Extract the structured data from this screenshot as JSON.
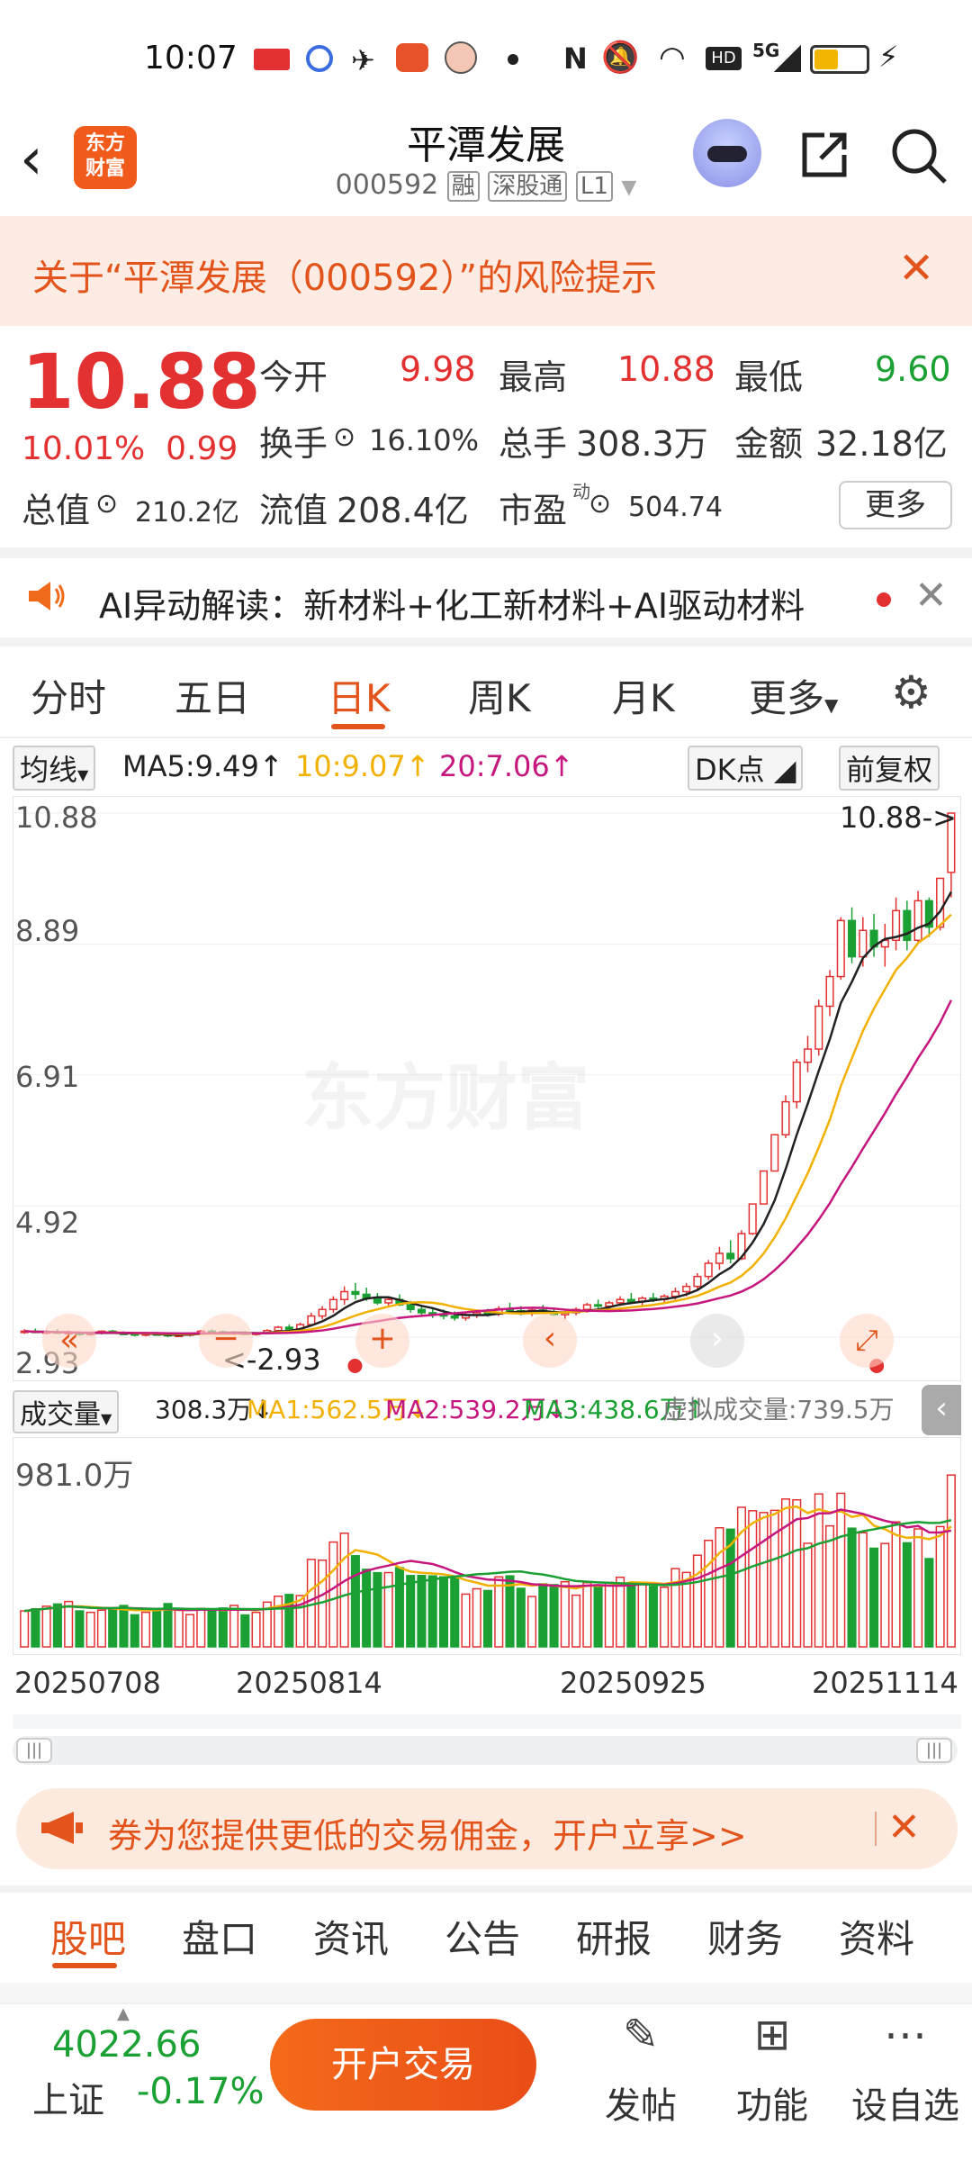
{
  "status_bar": {
    "time": "10:07",
    "network": "5G",
    "hd": "HD",
    "icons": [
      "toutiao-icon",
      "baidu-icon",
      "feather-icon",
      "gift-icon",
      "avatar-icon",
      "dot-icon",
      "nfc-icon",
      "mute-icon",
      "wifi-icon",
      "hd-icon",
      "signal-icon",
      "battery-icon",
      "charging-icon"
    ]
  },
  "header": {
    "app_logo": "东方\n财富",
    "stock_name": "平潭发展",
    "stock_code": "000592",
    "tags": [
      "融",
      "深股通",
      "L1"
    ]
  },
  "risk_banner": {
    "text": "关于“平潭发展（000592）”的风险提示"
  },
  "quote": {
    "price": "10.88",
    "change_pct": "10.01%",
    "change_amt": "0.99",
    "open_label": "今开",
    "open": "9.98",
    "high_label": "最高",
    "high": "10.88",
    "low_label": "最低",
    "low": "9.60",
    "turnover_label": "换手",
    "turnover": "16.10%",
    "volume_label": "总手",
    "volume": "308.3万",
    "amount_label": "金额",
    "amount": "32.18亿",
    "mktcap_label": "总值",
    "mktcap": "210.2亿",
    "float_label": "流值",
    "float": "208.4亿",
    "pe_label": "市盈",
    "pe_sup": "动",
    "pe": "504.74",
    "more_label": "更多"
  },
  "ai_bar": {
    "text": "AI异动解读：新材料+化工新材料+AI驱动材料"
  },
  "chart_tabs": [
    "分时",
    "五日",
    "日K",
    "周K",
    "月K",
    "更多"
  ],
  "active_chart_tab": "日K",
  "ma_row": {
    "selector": "均线",
    "ma5": "MA5:9.49",
    "ma10": "10:9.07",
    "ma20": "20:7.06",
    "dk_label": "DK点",
    "adjust_label": "前复权"
  },
  "colors": {
    "up": "#e33131",
    "down": "#1aa033",
    "ma5": "#222222",
    "ma10": "#f2b100",
    "ma20": "#c5177d",
    "accent": "#e2541b"
  },
  "kline": {
    "y_labels": [
      "10.88",
      "8.89",
      "6.91",
      "4.92",
      "2.93"
    ],
    "last_price_tag": "10.88->",
    "min_tag": "<-2.93",
    "watermark": "东方财富"
  },
  "volume_row": {
    "selector": "成交量",
    "vol": "308.3万",
    "ma1": "MA1:562.5万",
    "ma2": "MA2:539.2万",
    "ma3": "MA3:438.6万",
    "virtual": "虚拟成交量:739.5万",
    "y_label": "981.0万"
  },
  "dates": [
    "20250708",
    "20250814",
    "20250925",
    "20251114"
  ],
  "chart_data": {
    "type": "candlestick",
    "ylim": [
      2.93,
      10.88
    ],
    "y_ticks": [
      10.88,
      8.89,
      6.91,
      4.92,
      2.93
    ],
    "x_ticks": [
      "20250708",
      "20250814",
      "20250925",
      "20251114"
    ],
    "ohlc": [
      [
        3.0,
        3.05,
        2.98,
        3.02
      ],
      [
        3.02,
        3.06,
        2.99,
        3.0
      ],
      [
        3.0,
        3.04,
        2.97,
        3.01
      ],
      [
        3.01,
        3.05,
        2.98,
        2.99
      ],
      [
        2.99,
        3.03,
        2.96,
        3.0
      ],
      [
        3.0,
        3.02,
        2.95,
        2.97
      ],
      [
        2.97,
        3.01,
        2.95,
        2.99
      ],
      [
        2.99,
        3.03,
        2.97,
        3.02
      ],
      [
        3.02,
        3.04,
        2.98,
        2.99
      ],
      [
        2.99,
        3.02,
        2.96,
        2.98
      ],
      [
        2.98,
        3.0,
        2.94,
        2.96
      ],
      [
        2.96,
        3.0,
        2.94,
        2.98
      ],
      [
        2.98,
        3.01,
        2.95,
        2.97
      ],
      [
        2.97,
        3.0,
        2.93,
        2.95
      ],
      [
        2.95,
        2.98,
        2.93,
        2.96
      ],
      [
        2.96,
        3.0,
        2.94,
        2.99
      ],
      [
        2.99,
        3.04,
        2.97,
        3.02
      ],
      [
        3.02,
        3.05,
        2.99,
        3.01
      ],
      [
        3.01,
        3.03,
        2.97,
        2.98
      ],
      [
        2.98,
        3.02,
        2.96,
        3.0
      ],
      [
        3.0,
        3.02,
        2.96,
        2.97
      ],
      [
        2.97,
        3.01,
        2.95,
        2.99
      ],
      [
        2.99,
        3.05,
        2.97,
        3.03
      ],
      [
        3.03,
        3.1,
        3.01,
        3.08
      ],
      [
        3.08,
        3.12,
        3.03,
        3.05
      ],
      [
        3.05,
        3.15,
        3.04,
        3.12
      ],
      [
        3.12,
        3.3,
        3.1,
        3.25
      ],
      [
        3.25,
        3.4,
        3.2,
        3.35
      ],
      [
        3.35,
        3.55,
        3.3,
        3.5
      ],
      [
        3.5,
        3.7,
        3.42,
        3.62
      ],
      [
        3.62,
        3.75,
        3.5,
        3.58
      ],
      [
        3.58,
        3.68,
        3.48,
        3.52
      ],
      [
        3.52,
        3.6,
        3.42,
        3.45
      ],
      [
        3.45,
        3.55,
        3.38,
        3.5
      ],
      [
        3.5,
        3.58,
        3.4,
        3.42
      ],
      [
        3.42,
        3.48,
        3.3,
        3.35
      ],
      [
        3.35,
        3.42,
        3.25,
        3.3
      ],
      [
        3.3,
        3.38,
        3.22,
        3.28
      ],
      [
        3.28,
        3.35,
        3.2,
        3.25
      ],
      [
        3.25,
        3.32,
        3.18,
        3.22
      ],
      [
        3.22,
        3.3,
        3.18,
        3.27
      ],
      [
        3.27,
        3.35,
        3.22,
        3.3
      ],
      [
        3.3,
        3.36,
        3.24,
        3.28
      ],
      [
        3.28,
        3.4,
        3.25,
        3.36
      ],
      [
        3.36,
        3.45,
        3.3,
        3.33
      ],
      [
        3.33,
        3.4,
        3.26,
        3.3
      ],
      [
        3.3,
        3.36,
        3.25,
        3.34
      ],
      [
        3.34,
        3.42,
        3.28,
        3.31
      ],
      [
        3.31,
        3.38,
        3.25,
        3.27
      ],
      [
        3.27,
        3.33,
        3.2,
        3.3
      ],
      [
        3.3,
        3.38,
        3.26,
        3.35
      ],
      [
        3.35,
        3.45,
        3.3,
        3.42
      ],
      [
        3.42,
        3.5,
        3.36,
        3.4
      ],
      [
        3.4,
        3.48,
        3.34,
        3.45
      ],
      [
        3.45,
        3.55,
        3.4,
        3.5
      ],
      [
        3.5,
        3.6,
        3.44,
        3.47
      ],
      [
        3.47,
        3.55,
        3.4,
        3.52
      ],
      [
        3.52,
        3.6,
        3.46,
        3.5
      ],
      [
        3.5,
        3.58,
        3.45,
        3.55
      ],
      [
        3.55,
        3.68,
        3.5,
        3.62
      ],
      [
        3.62,
        3.75,
        3.55,
        3.7
      ],
      [
        3.7,
        3.9,
        3.65,
        3.85
      ],
      [
        3.85,
        4.1,
        3.8,
        4.05
      ],
      [
        4.05,
        4.3,
        3.95,
        4.2
      ],
      [
        4.2,
        4.4,
        4.05,
        4.12
      ],
      [
        4.12,
        4.55,
        4.1,
        4.5
      ],
      [
        4.5,
        4.95,
        4.48,
        4.95
      ],
      [
        4.95,
        5.45,
        4.95,
        5.45
      ],
      [
        5.45,
        6.0,
        5.45,
        6.0
      ],
      [
        6.0,
        6.6,
        5.95,
        6.5
      ],
      [
        6.5,
        7.15,
        6.4,
        7.1
      ],
      [
        7.1,
        7.5,
        6.95,
        7.3
      ],
      [
        7.3,
        8.05,
        7.2,
        7.95
      ],
      [
        7.95,
        8.5,
        7.8,
        8.4
      ],
      [
        8.4,
        9.3,
        8.35,
        9.25
      ],
      [
        9.25,
        9.45,
        8.6,
        8.7
      ],
      [
        8.7,
        9.3,
        8.55,
        9.1
      ],
      [
        9.1,
        9.35,
        8.7,
        8.85
      ],
      [
        8.85,
        9.2,
        8.55,
        8.95
      ],
      [
        8.95,
        9.6,
        8.8,
        9.4
      ],
      [
        9.4,
        9.55,
        8.8,
        8.95
      ],
      [
        8.95,
        9.7,
        8.9,
        9.55
      ],
      [
        9.55,
        9.6,
        9.0,
        9.15
      ],
      [
        9.15,
        9.9,
        9.1,
        9.89
      ],
      [
        9.98,
        10.88,
        9.6,
        10.88
      ]
    ],
    "ma5": 9.49,
    "ma10": 9.07,
    "ma20": 7.06,
    "volume_ylim": [
      0,
      981.0
    ],
    "volume_unit": "万"
  },
  "promo": {
    "text": "券为您提供更低的交易佣金，开户立享>>"
  },
  "bottom_tabs": [
    "股吧",
    "盘口",
    "资讯",
    "公告",
    "研报",
    "财务",
    "资料"
  ],
  "footer": {
    "index_value": "4022.66",
    "index_name": "上证",
    "index_change": "-0.17%",
    "trade_button": "开户交易",
    "post_label": "发帖",
    "func_label": "功能",
    "watch_label": "设自选"
  }
}
